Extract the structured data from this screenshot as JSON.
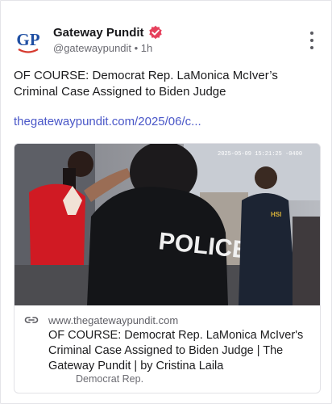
{
  "post": {
    "author_name": "Gateway Pundit",
    "avatar_text": "GP",
    "handle_time": "@gatewaypundit • 1h",
    "text": "OF COURSE: Democrat Rep. LaMonica McIver’s Criminal Case Assigned to Biden Judge",
    "link": "thegatewaypundit.com/2025/06/c..."
  },
  "link_card": {
    "image_overlay_text": "POLICE",
    "image_vest_text": "HSI",
    "image_timestamp": "2025-05-09 15:21:25 -0400",
    "domain": "www.thegatewaypundit.com",
    "title": "OF COURSE: Democrat Rep. LaMonica McIver's Criminal Case Assigned to Biden Judge | The Gateway Pundit | by Cristina Laila",
    "description": "Democrat Rep."
  },
  "colors": {
    "link": "#4a57c8",
    "verified_badge": "#e6405c",
    "avatar_blue": "#1f4fa3",
    "avatar_red": "#d63a2f"
  }
}
